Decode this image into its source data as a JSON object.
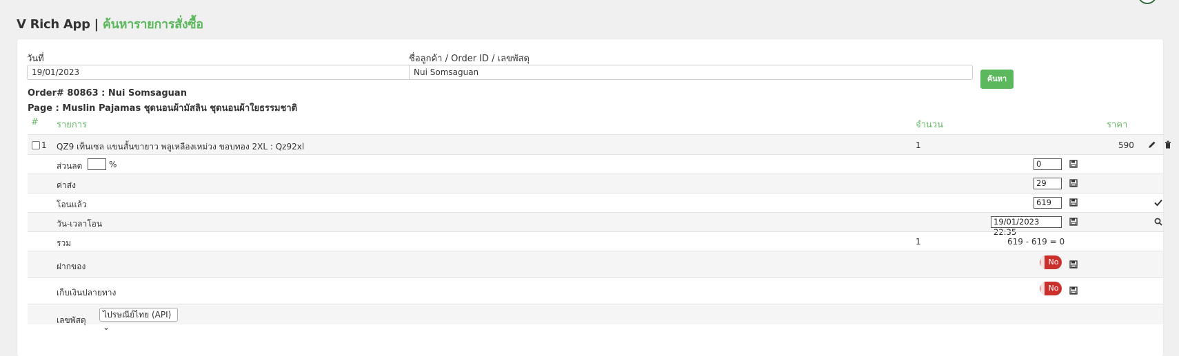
{
  "header": {
    "app_name": "V Rich App |",
    "page_title": "ค้นหารายการสั่งซื้อ"
  },
  "search": {
    "date_label": "วันที่",
    "date_value": "19/01/2023",
    "query_label": "ชื่อลูกค้า / Order ID / เลขพัสดุ",
    "query_value": "Nui Somsaguan",
    "button_label": "ค้นหา"
  },
  "order": {
    "title": "Order# 80863 : Nui Somsaguan",
    "page": "Page : Muslin Pajamas ชุดนอนผ้ามัสลิน ชุดนอนผ้าใยธรรมชาติ"
  },
  "table": {
    "headers": {
      "index": "#",
      "item": "รายการ",
      "qty": "จำนวน",
      "price": "ราคา"
    },
    "items": [
      {
        "index": "1",
        "name": "QZ9 เท็นเซล แขนสั้นขายาว พลูเหลืองเหม่วง ขอบทอง 2XL : Qz92xl",
        "qty": "1",
        "price": "590"
      }
    ]
  },
  "summary": {
    "discount_label": "ส่วนลด",
    "discount_percent_value": "",
    "percent_sign": "%",
    "discount_value": "0",
    "shipping_label": "ค่าส่ง",
    "shipping_value": "29",
    "paid_label": "โอนแล้ว",
    "paid_value": "619",
    "transfer_time_label": "วัน-เวลาโอน",
    "transfer_time_value": "19/01/2023 22:35",
    "total_label": "รวม",
    "total_qty": "1",
    "total_text": "619 - 619 = 0",
    "deposit_label": "ฝากของ",
    "deposit_toggle": "No",
    "cod_label": "เก็บเงินปลายทาง",
    "cod_toggle": "No",
    "tracking_label": "เลขพัสดุ",
    "tracking_select": "ไปรษณีย์ไทย (API)"
  },
  "colors": {
    "accent": "#5cb85c",
    "danger": "#c9302c"
  }
}
